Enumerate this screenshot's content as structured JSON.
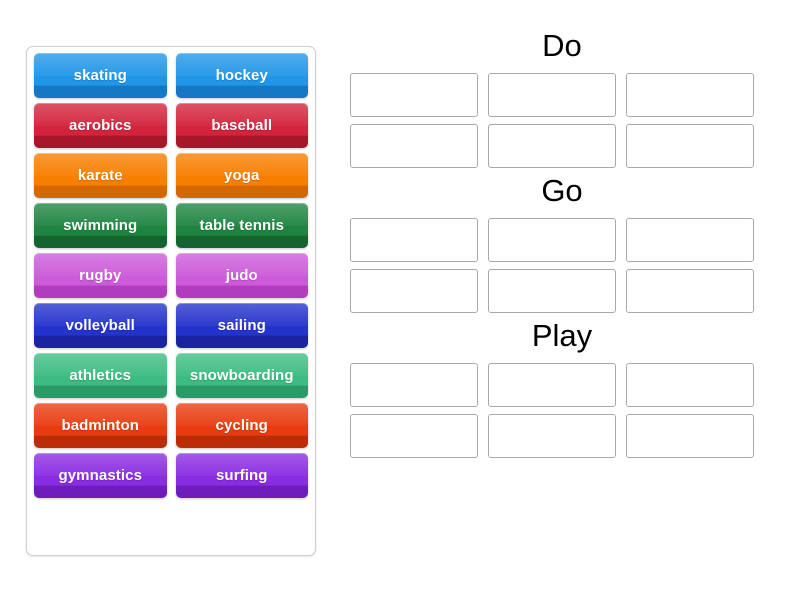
{
  "tile_pool": {
    "name": "sports-word-bank",
    "rows": [
      [
        {
          "label": "skating",
          "color": "#2196e8",
          "color_dark": "#1678c4"
        },
        {
          "label": "hockey",
          "color": "#2196e8",
          "color_dark": "#1678c4"
        }
      ],
      [
        {
          "label": "aerobics",
          "color": "#d3243c",
          "color_dark": "#a8162c"
        },
        {
          "label": "baseball",
          "color": "#d3243c",
          "color_dark": "#a8162c"
        }
      ],
      [
        {
          "label": "karate",
          "color": "#f77f00",
          "color_dark": "#d46800"
        },
        {
          "label": "yoga",
          "color": "#f77f00",
          "color_dark": "#d46800"
        }
      ],
      [
        {
          "label": "swimming",
          "color": "#1e8541",
          "color_dark": "#13642f"
        },
        {
          "label": "table tennis",
          "color": "#1e8541",
          "color_dark": "#13642f"
        }
      ],
      [
        {
          "label": "rugby",
          "color": "#cc5ada",
          "color_dark": "#b03cbe"
        },
        {
          "label": "judo",
          "color": "#cc5ada",
          "color_dark": "#b03cbe"
        }
      ],
      [
        {
          "label": "volleyball",
          "color": "#2433cb",
          "color_dark": "#1a23a0"
        },
        {
          "label": "sailing",
          "color": "#2433cb",
          "color_dark": "#1a23a0"
        }
      ],
      [
        {
          "label": "athletics",
          "color": "#3cbc81",
          "color_dark": "#2a9b67"
        },
        {
          "label": "snowboarding",
          "color": "#3cbc81",
          "color_dark": "#2a9b67"
        }
      ],
      [
        {
          "label": "badminton",
          "color": "#e83c10",
          "color_dark": "#bd2c08"
        },
        {
          "label": "cycling",
          "color": "#e83c10",
          "color_dark": "#bd2c08"
        }
      ],
      [
        {
          "label": "gymnastics",
          "color": "#8a2ce2",
          "color_dark": "#6d1dbb"
        },
        {
          "label": "surfing",
          "color": "#8a2ce2",
          "color_dark": "#6d1dbb"
        }
      ]
    ]
  },
  "categories": [
    {
      "title": "Do",
      "slot_rows": [
        3,
        3
      ]
    },
    {
      "title": "Go",
      "slot_rows": [
        3,
        3
      ]
    },
    {
      "title": "Play",
      "slot_rows": [
        3,
        3
      ]
    }
  ]
}
